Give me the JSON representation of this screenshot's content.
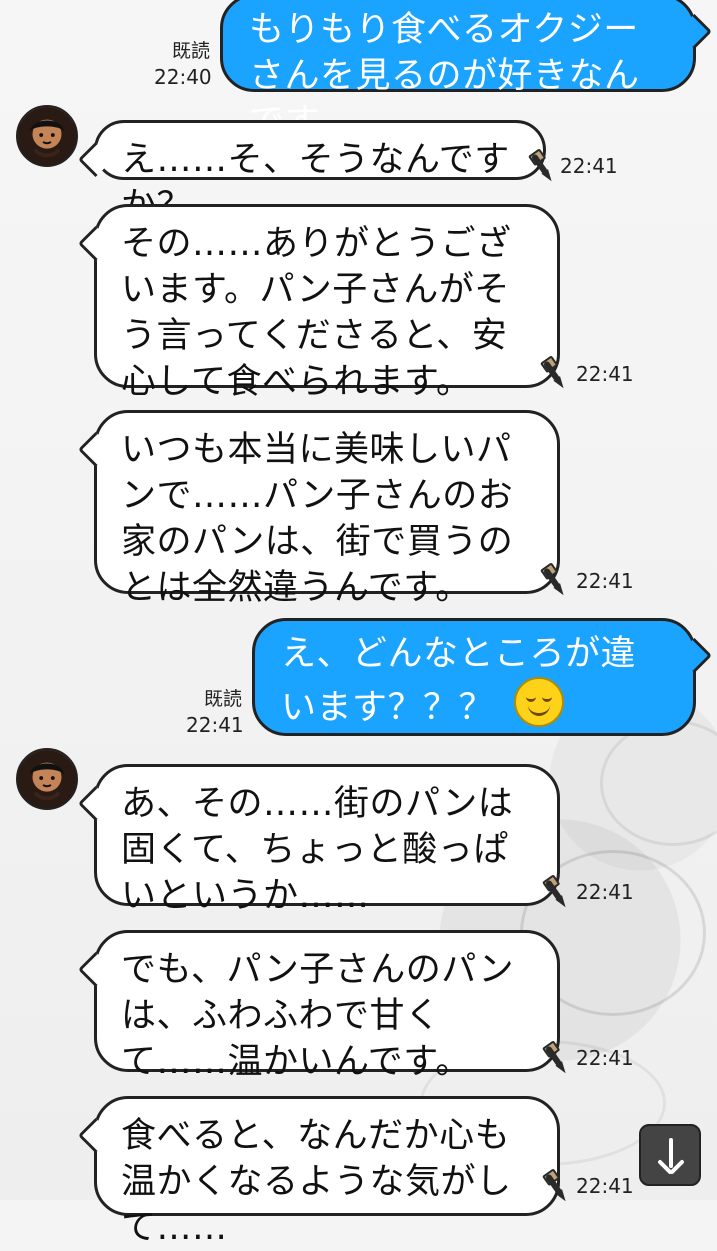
{
  "messages": [
    {
      "side": "right",
      "read_label": "既読",
      "time": "22:40",
      "text": "もりもり食べるオクジーさんを見るのが好きなんです"
    },
    {
      "side": "left",
      "time": "22:41",
      "text": "え……そ、そうなんですか？"
    },
    {
      "side": "left",
      "time": "22:41",
      "text": "その……ありがとうございます。パン子さんがそう言ってくださると、安心して食べられます。"
    },
    {
      "side": "left",
      "time": "22:41",
      "text": "いつも本当に美味しいパンで……パン子さんのお家のパンは、街で買うのとは全然違うんです。"
    },
    {
      "side": "right",
      "read_label": "既読",
      "time": "22:41",
      "text": "え、どんなところが違います？？？",
      "emoji": "smiling-face-icon"
    },
    {
      "side": "left",
      "time": "22:41",
      "text": "あ、その……街のパンは固くて、ちょっと酸っぱいというか……"
    },
    {
      "side": "left",
      "time": "22:41",
      "text": "でも、パン子さんのパンは、ふわふわで甘くて……温かいんです。"
    },
    {
      "side": "left",
      "time": "22:41",
      "text": "食べると、なんだか心も温かくなるような気がして……"
    }
  ],
  "ui": {
    "scroll_down_icon": "arrow-down-icon",
    "accent": "#1aa3ff",
    "bubble_border": "#222222",
    "bubble_left_bg": "#ffffff"
  }
}
